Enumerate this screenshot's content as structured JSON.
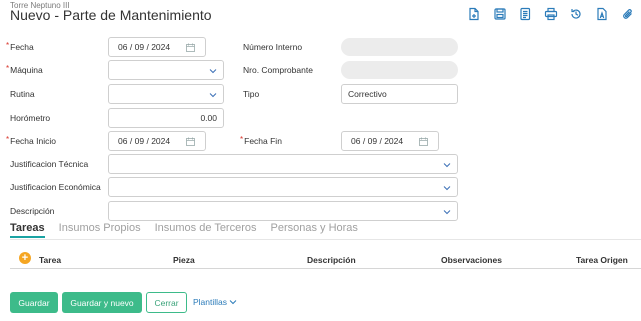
{
  "header": {
    "subtitle": "Torre Neptuno III",
    "title": "Nuevo - Parte de Mantenimiento"
  },
  "toolbar": {
    "icons": [
      "new-document-icon",
      "save-icon",
      "notes-icon",
      "print-icon",
      "history-icon",
      "export-icon",
      "attachment-icon"
    ]
  },
  "form": {
    "required_mark": "*",
    "fecha": {
      "label": "Fecha",
      "day": "06",
      "month": "09",
      "year": "2024"
    },
    "numero_interno": {
      "label": "Número Interno",
      "value": ""
    },
    "maquina": {
      "label": "Máquina",
      "value": ""
    },
    "nro_comprobante": {
      "label": "Nro. Comprobante",
      "value": ""
    },
    "rutina": {
      "label": "Rutina",
      "value": ""
    },
    "tipo": {
      "label": "Tipo",
      "value": "Correctivo"
    },
    "horometro": {
      "label": "Horómetro",
      "value": "0.00"
    },
    "fecha_inicio": {
      "label": "Fecha Inicio",
      "day": "06",
      "month": "09",
      "year": "2024"
    },
    "fecha_fin": {
      "label": "Fecha Fin",
      "day": "06",
      "month": "09",
      "year": "2024"
    },
    "just_tecnica": {
      "label": "Justificacion Técnica",
      "value": ""
    },
    "just_economica": {
      "label": "Justificacion Económica",
      "value": ""
    },
    "descripcion": {
      "label": "Descripción",
      "value": ""
    },
    "date_sep": "/"
  },
  "tabs": [
    "Tareas",
    "Insumos Propios",
    "Insumos de Terceros",
    "Personas y Horas"
  ],
  "table": {
    "add_symbol": "+",
    "columns": [
      "Tarea",
      "Pieza",
      "Descripción",
      "Observaciones",
      "Tarea Origen"
    ]
  },
  "actions": {
    "save": "Guardar",
    "save_new": "Guardar y nuevo",
    "close": "Cerrar",
    "templates": "Plantillas"
  },
  "colors": {
    "accent": "#2b7bb9",
    "primary_button": "#3dbb8a",
    "required": "#d9342b",
    "tab_active": "#1aa3a3",
    "add_button": "#f5a623"
  }
}
